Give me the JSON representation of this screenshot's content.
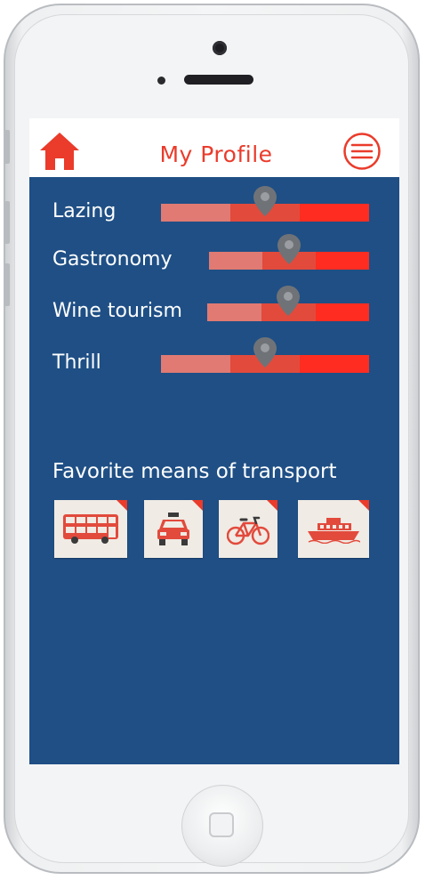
{
  "header": {
    "title": "My Profile",
    "home_icon": "home-icon",
    "menu_icon": "hamburger-menu-icon"
  },
  "preferences": [
    {
      "label": "Lazing",
      "level": 0.5
    },
    {
      "label": "Gastronomy",
      "level": 0.5
    },
    {
      "label": "Wine tourism",
      "level": 0.5
    },
    {
      "label": "Thrill",
      "level": 0.5
    }
  ],
  "transport": {
    "title": "Favorite means of transport",
    "options": [
      {
        "icon": "bus-icon"
      },
      {
        "icon": "taxi-icon"
      },
      {
        "icon": "bicycle-icon"
      },
      {
        "icon": "ferry-icon"
      }
    ]
  },
  "colors": {
    "accent": "#ea3b2b",
    "panel": "#1f4f85",
    "slider_low": "#e07a72",
    "slider_mid": "#e24a3c",
    "slider_high": "#ff2d21",
    "pin": "#6f7377"
  }
}
